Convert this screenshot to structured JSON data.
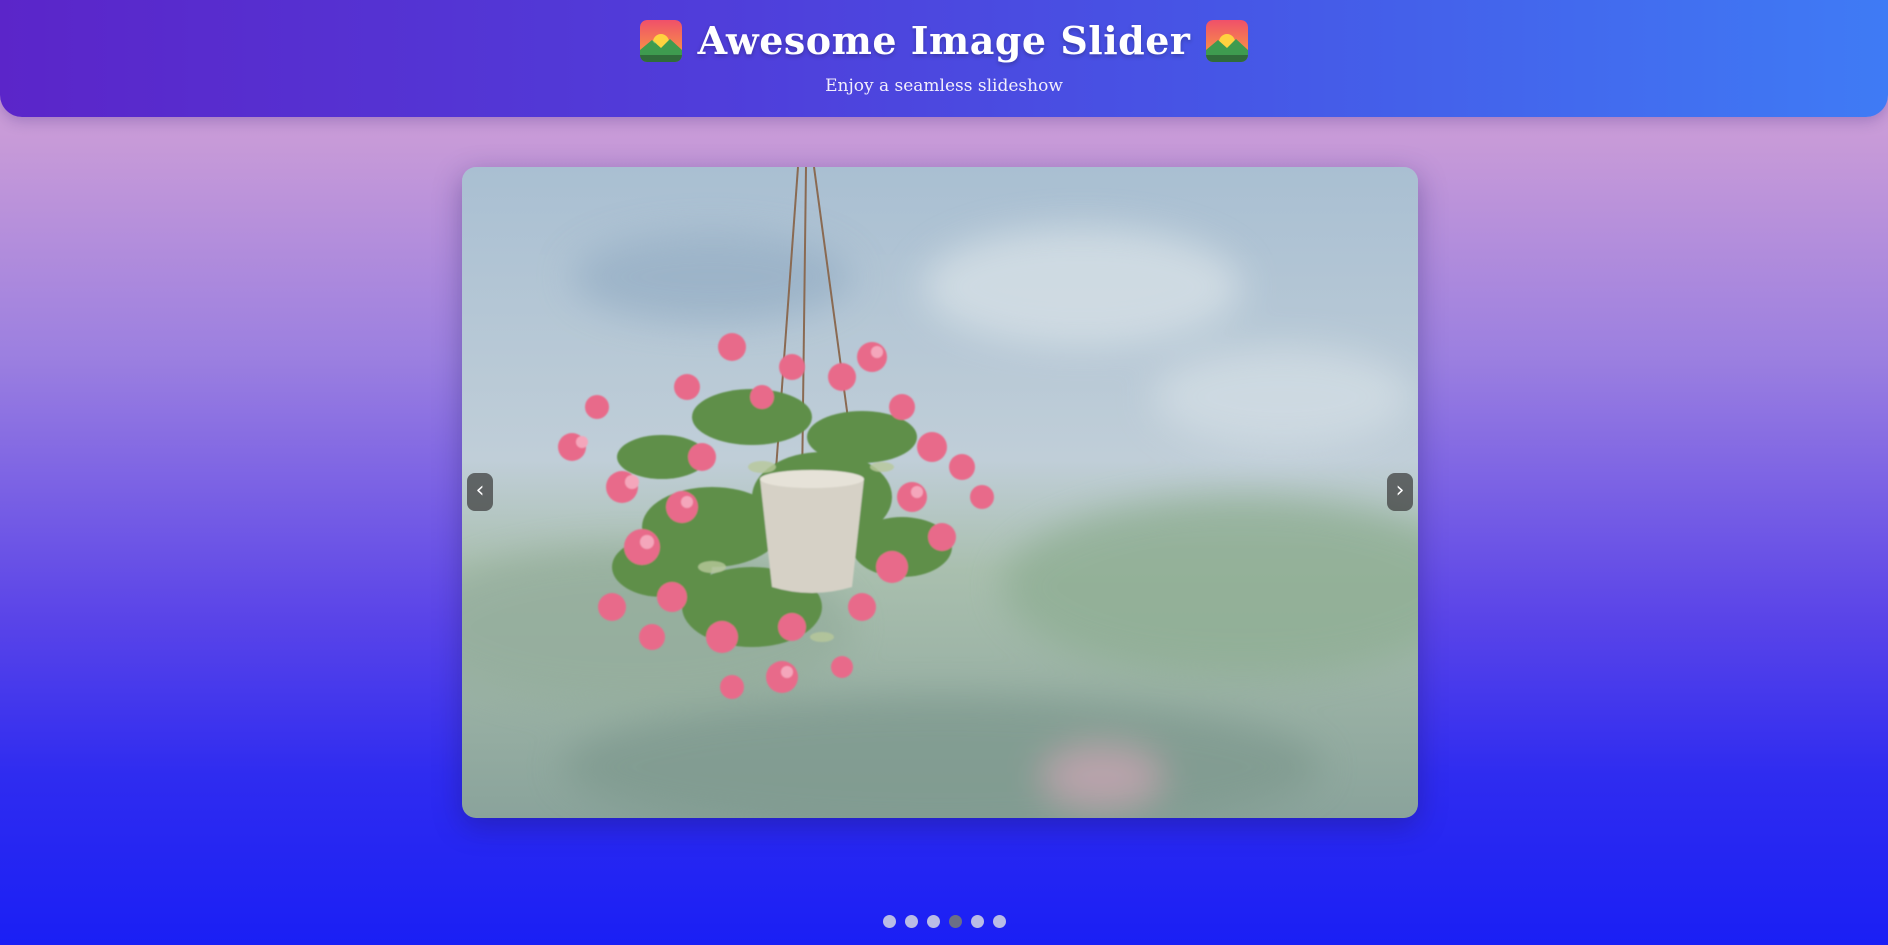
{
  "header": {
    "title": "Awesome Image Slider",
    "subtitle": "Enjoy a seamless slideshow",
    "title_icon": "sunrise-over-mountains-icon"
  },
  "slider": {
    "prev_label": "‹",
    "next_label": "›",
    "slide_count": 6,
    "active_index": 4,
    "current_image": "hanging pot of pink petunias against blurred sky and hills"
  },
  "colors": {
    "header_start": "#5b25c9",
    "header_end": "#3f7bf5",
    "dot_inactive": "#b9bce6",
    "dot_active": "#6b6f86"
  }
}
